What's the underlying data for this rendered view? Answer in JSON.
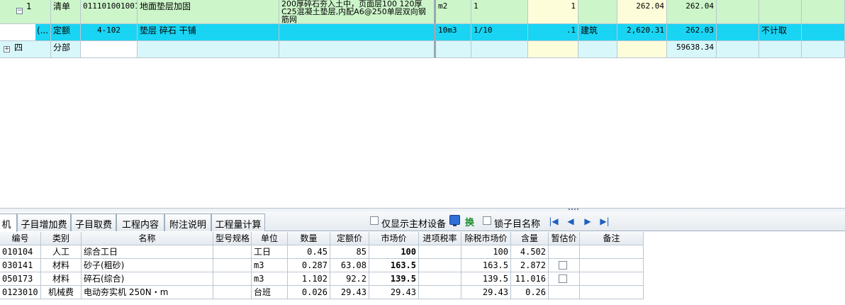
{
  "upper_rows": [
    {
      "id": "1",
      "type": "清单",
      "code": "011101001001",
      "name": "地面垫层加固",
      "feature": "200厚碎石夯入土中，页面层100 120厚C25混凝土垫层,内配A6@250单层双向钢筋网",
      "unit": "m2",
      "expr": "1",
      "qty": "1",
      "discipline": "",
      "unit_price": "262.04",
      "total": "262.04",
      "pricing": ""
    },
    {
      "id": "(...",
      "type": "定额",
      "code": "4-102",
      "name": "垫层 碎石 干铺",
      "feature": "",
      "unit": "10m3",
      "expr": "1/10",
      "qty": ".1",
      "discipline": "建筑",
      "unit_price": "2,620.31",
      "total": "262.03",
      "pricing": "不计取"
    },
    {
      "id": "四",
      "type": "分部",
      "code": "",
      "name": "",
      "feature": "",
      "unit": "",
      "expr": "",
      "qty": "",
      "discipline": "",
      "unit_price": "",
      "total": "59638.34",
      "pricing": ""
    }
  ],
  "tabs": [
    "机",
    "子目增加费",
    "子目取费",
    "工程内容",
    "附注说明",
    "工程量计算"
  ],
  "toolbar": {
    "main_material_only": "仅显示主材设备",
    "swap": "换",
    "lock_name": "锁子目名称"
  },
  "lower_table": {
    "headers": [
      "编号",
      "类别",
      "名称",
      "型号规格",
      "单位",
      "数量",
      "定额价",
      "市场价",
      "进项税率",
      "除税市场价",
      "含量",
      "暂估价",
      "备注"
    ],
    "rows": [
      {
        "code": "010104",
        "category": "人工",
        "name": "综合工日",
        "spec": "",
        "unit": "工日",
        "qty": "0.45",
        "quota_price": "85",
        "market_price": "100",
        "tax_rate": "",
        "net_price": "100",
        "content": "4.502",
        "has_est": false,
        "note": ""
      },
      {
        "code": "030141",
        "category": "材料",
        "name": "砂子(粗砂)",
        "spec": "",
        "unit": "m3",
        "qty": "0.287",
        "quota_price": "63.08",
        "market_price": "163.5",
        "tax_rate": "",
        "net_price": "163.5",
        "content": "2.872",
        "has_est": true,
        "note": ""
      },
      {
        "code": "050173",
        "category": "材料",
        "name": "碎石(综合)",
        "spec": "",
        "unit": "m3",
        "qty": "1.102",
        "quota_price": "92.2",
        "market_price": "139.5",
        "tax_rate": "",
        "net_price": "139.5",
        "content": "11.016",
        "has_est": true,
        "note": ""
      },
      {
        "code": "0123010",
        "category": "机械费",
        "name": "电动夯实机 250N・m",
        "spec": "",
        "unit": "台班",
        "qty": "0.026",
        "quota_price": "29.43",
        "market_price": "29.43",
        "tax_rate": "",
        "net_price": "29.43",
        "content": "0.26",
        "has_est": false,
        "note": ""
      }
    ]
  }
}
